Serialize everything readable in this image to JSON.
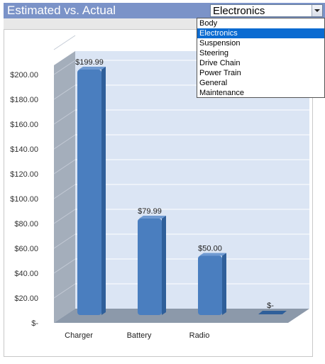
{
  "title": "Estimated vs. Actual",
  "category_select": {
    "value": "Electronics",
    "options": [
      "Body",
      "Electronics",
      "Suspension",
      "Steering",
      "Drive Chain",
      "Power Train",
      "General",
      "Maintenance"
    ],
    "selected_index": 1
  },
  "chart_data": {
    "type": "bar",
    "categories": [
      "Charger",
      "Battery",
      "Radio",
      ""
    ],
    "values": [
      199.99,
      79.99,
      50.0,
      0
    ],
    "data_labels": [
      "$199.99",
      "$79.99",
      "$50.00",
      "$-"
    ],
    "y_ticks": [
      "$-",
      "$20.00",
      "$40.00",
      "$60.00",
      "$80.00",
      "$100.00",
      "$120.00",
      "$140.00",
      "$160.00",
      "$180.00",
      "$200.00"
    ],
    "ylim": [
      0,
      220
    ],
    "grid": true,
    "bar_color": "#4a7ebf",
    "wall_color": "#dbe5f4",
    "floor_color": "#8c99aa"
  }
}
